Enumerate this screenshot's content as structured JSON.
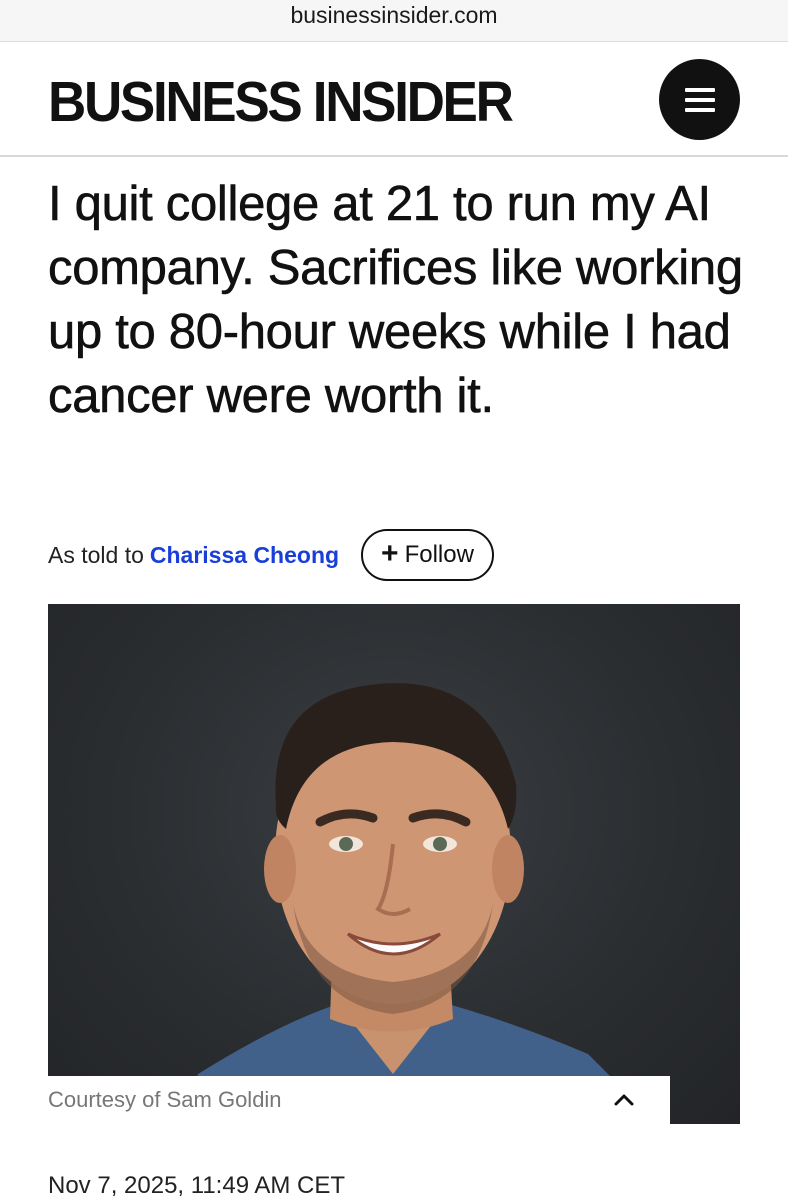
{
  "browser": {
    "url": "businessinsider.com"
  },
  "masthead": {
    "logo": "BUSINESS INSIDER",
    "menu_icon": "hamburger-menu-icon"
  },
  "article": {
    "headline": "I quit college at 21 to run my AI company. Sacrifices like working up to 80-hour weeks while I had cancer were worth it.",
    "byline_prefix": "As told to",
    "author": "Charissa Cheong",
    "follow_label": "Follow",
    "follow_icon": "plus-icon",
    "caption": "Courtesy of Sam Goldin",
    "caption_toggle_icon": "chevron-up-icon",
    "date": "Nov 7, 2025, 11:49 AM CET"
  },
  "colors": {
    "author_link": "#1a3fd8",
    "menu_bg": "#111111"
  }
}
